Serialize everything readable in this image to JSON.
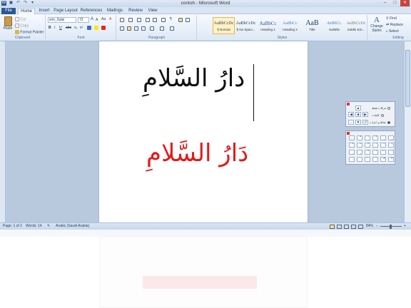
{
  "window": {
    "title": "contoh - Microsoft Word",
    "min": "–",
    "max": "□",
    "close": "✕"
  },
  "qat": {
    "icon_word": "W",
    "save": "▣",
    "undo": "↶",
    "redo": "↷",
    "more": "▾"
  },
  "tabs": [
    "File",
    "Home",
    "Insert",
    "Page Layout",
    "References",
    "Mailings",
    "Review",
    "View"
  ],
  "clipboard": {
    "paste": "Paste",
    "cut": "Cut",
    "copy": "Copy",
    "format_painter": "Format Painter",
    "label": "Clipboard"
  },
  "font": {
    "name": "wm_Salsi",
    "size": "72",
    "label": "Font",
    "bold": "B",
    "italic": "I",
    "underline": "U",
    "strike": "abc",
    "sub": "x₂",
    "sup": "x²",
    "grow": "A",
    "shrink": "A",
    "aa": "Aa",
    "clear": "A"
  },
  "paragraph": {
    "label": "Paragraph",
    "pilcrow": "¶"
  },
  "styles": {
    "label": "Styles",
    "items": [
      {
        "preview": "AaBbCcDc",
        "name": "¶ Normal"
      },
      {
        "preview": "AaBbCcDc",
        "name": "¶ No Spaci..."
      },
      {
        "preview": "AaBbCc",
        "name": "Heading 1"
      },
      {
        "preview": "AaBbCc",
        "name": "Heading 2"
      },
      {
        "preview": "AaB",
        "name": "Title"
      },
      {
        "preview": "AaBbCc.",
        "name": "Subtitle"
      },
      {
        "preview": "AaBbCcDc",
        "name": "Subtle Em..."
      }
    ],
    "change": "Change Styles"
  },
  "editing": {
    "label": "Editing",
    "find": "Find",
    "replace": "Replace",
    "select": "Select"
  },
  "document": {
    "line1": "دارُ السَّلامِ",
    "line2": "دَارُ السَّلامِ"
  },
  "palette1": {
    "options": [
      "حركات فقط",
      "كلمات",
      "نقاط و اعراب"
    ],
    "selected": 2
  },
  "palette2": {
    "glyphs": [
      "ـ",
      "ّ",
      "َ",
      "ٌ",
      "ِ",
      "ٍ",
      "ُ",
      "ً",
      "ْ",
      "ٰ",
      "ٓ",
      "ٔ",
      "ٕ",
      "ٖ",
      "ٗ",
      "٘",
      "ٙ",
      "ٚ",
      "ٛ",
      "ٜ",
      "ٝ",
      "ٞ",
      "ۖ",
      "ۗ"
    ]
  },
  "status": {
    "page": "Page: 1 of 2",
    "words": "Words: 14",
    "lang": "Arabic (Saudi Arabia)",
    "zoom": "84%",
    "minus": "−",
    "plus": "+"
  },
  "colors": {
    "accent": "#2b5797",
    "red_text": "#e21b1b",
    "ribbon_bg": "#dde8f5"
  }
}
